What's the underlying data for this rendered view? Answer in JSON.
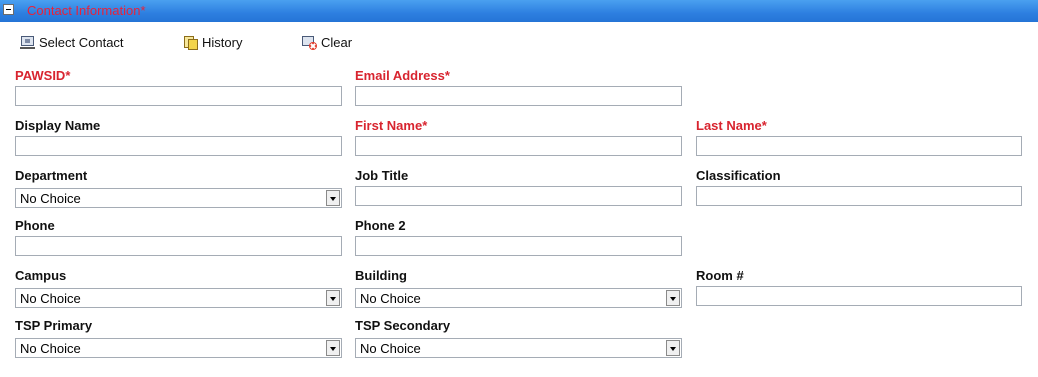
{
  "section": {
    "title": "Contact Information*"
  },
  "toolbar": {
    "select_contact": "Select Contact",
    "history": "History",
    "clear": "Clear"
  },
  "fields": {
    "pawsid": {
      "label": "PAWSID*"
    },
    "email": {
      "label": "Email Address*"
    },
    "display_name": {
      "label": "Display Name"
    },
    "first_name": {
      "label": "First Name*"
    },
    "last_name": {
      "label": "Last Name*"
    },
    "department": {
      "label": "Department",
      "value": "No Choice"
    },
    "job_title": {
      "label": "Job Title"
    },
    "classification": {
      "label": "Classification"
    },
    "phone": {
      "label": "Phone"
    },
    "phone2": {
      "label": "Phone 2"
    },
    "campus": {
      "label": "Campus",
      "value": "No Choice"
    },
    "building": {
      "label": "Building",
      "value": "No Choice"
    },
    "room": {
      "label": "Room #"
    },
    "tsp_primary": {
      "label": "TSP Primary",
      "value": "No Choice"
    },
    "tsp_secondary": {
      "label": "TSP Secondary",
      "value": "No Choice"
    }
  },
  "colors": {
    "header_blue": "#2d7fe0",
    "required_red": "#d8242f",
    "title_red": "#e8223a"
  }
}
